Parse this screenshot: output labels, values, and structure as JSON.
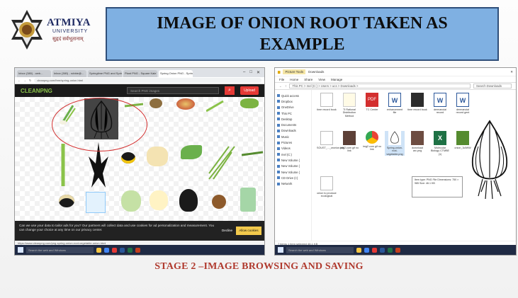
{
  "logo": {
    "brand": "ATMIYA",
    "university": "UNIVERSITY",
    "tagline": "सुहृदं सर्वभूतानाम्"
  },
  "title": "IMAGE OF ONION ROOT TAKEN AS EXAMPLE",
  "caption": "STAGE 2 –IMAGE  BROWSING  AND SAVING",
  "browser": {
    "tabs": [
      "Inbox (380) - web...",
      "Inbox (380) - robbie@...",
      "Springtime PNG and Spring...",
      "Plant PNG - Square Kale Tex...",
      "Spring Onion PNG - Spring..."
    ],
    "url": "cleanpng.com/free/spring-onion.html",
    "site_logo": "CLEANPNG",
    "search_placeholder": "Search PNG images",
    "upload_label": "Upload",
    "cookie_text": "Can we use your data to tailor ads for you? Our partners will collect data and use cookies for ad personalization and measurement. You can change your choice at any time on our privacy center.",
    "decline_label": "Decline",
    "allow_label": "Allow cookies",
    "status_url": "https://www.cleanpng.com/png-spring-onion-root-vegetable-onion.html",
    "taskbar_search": "Search the web and Windows"
  },
  "explorer": {
    "title": "Downloads",
    "picture_tools": "Picture Tools",
    "ribbon": [
      "File",
      "Home",
      "Share",
      "View",
      "Manage"
    ],
    "path": "This PC > mel (C:) > Users > ucs > Downloads >",
    "search_placeholder": "Search Downloads",
    "nav_items": [
      "Quick access",
      "Dropbox",
      "OneDrive",
      "This PC",
      "Desktop",
      "Documents",
      "Downloads",
      "Music",
      "Pictures",
      "Videos",
      "mel (C:)",
      "New Volume (",
      "New Volume (",
      "New Volume (",
      "CD Drive (I:)",
      "Network"
    ],
    "files": [
      {
        "name": "time record book",
        "type": "doc"
      },
      {
        "name": "TI Rational Distribution Method",
        "type": "doc"
      },
      {
        "name": "TC Center",
        "type": "pdf"
      },
      {
        "name": "enhancement file",
        "type": "word"
      },
      {
        "name": "time record book",
        "type": "dark"
      },
      {
        "name": "dermancial record",
        "type": "word"
      },
      {
        "name": "dermancial record gent",
        "type": "word"
      },
      {
        "name": "alldomy_77nf PDF",
        "type": "word"
      },
      {
        "name": "SOUST_..._oronion.pdf",
        "type": "doc"
      },
      {
        "name": "img2.com gif no link",
        "type": "img"
      },
      {
        "name": "img2.com gif no link",
        "type": "chrome"
      },
      {
        "name": "Spring-onion-root-vegetable.png",
        "type": "onion"
      },
      {
        "name": "download arc.png",
        "type": "photo"
      },
      {
        "name": "Molecular Biology CTMBE (1)",
        "type": "excel"
      },
      {
        "name": "onion_3d/WW",
        "type": "green"
      },
      {
        "name": "onion_plant as friendly",
        "type": "leaf"
      },
      {
        "name": "onion to produce ecological",
        "type": "doc"
      }
    ],
    "tooltip": "Item type: PNG File\nDimensions: 750 × 985\nSize: 46.1 KB",
    "status": "7 items   1 item selected  48.1 KB"
  },
  "colors": {
    "title_bg": "#7fb0e2",
    "caption": "#b03a2e",
    "cleanpng_bar": "#1b1b1b",
    "accent_red": "#e53935"
  }
}
